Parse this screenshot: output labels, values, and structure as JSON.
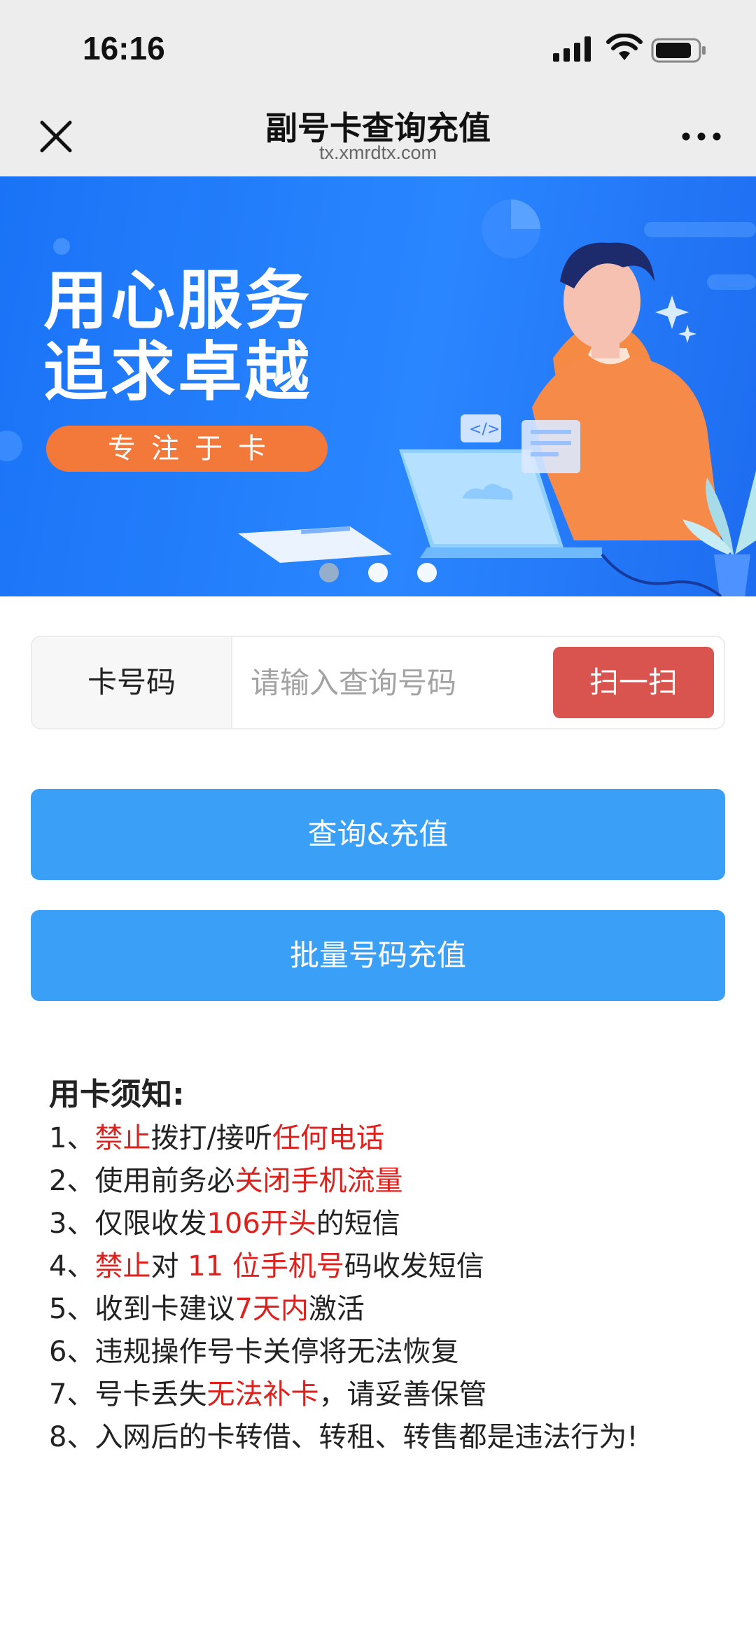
{
  "status_bar": {
    "time": "16:16"
  },
  "nav": {
    "title": "副号卡查询充值",
    "url": "tx.xmrdtx.com"
  },
  "banner": {
    "line1": "用心服务",
    "line2": "追求卓越",
    "tag": "专注于卡",
    "slides": 3,
    "active_slide": 1
  },
  "query": {
    "label": "卡号码",
    "placeholder": "请输入查询号码",
    "scan_label": "扫一扫"
  },
  "buttons": {
    "query_recharge": "查询&充值",
    "batch_recharge": "批量号码充值"
  },
  "notice": {
    "title": "用卡须知:",
    "items": [
      [
        {
          "t": "1、"
        },
        {
          "t": "禁止",
          "red": true
        },
        {
          "t": "拨打/接听"
        },
        {
          "t": "任何电话",
          "red": true
        }
      ],
      [
        {
          "t": "2、使用前务必"
        },
        {
          "t": "关闭手机流量",
          "red": true
        }
      ],
      [
        {
          "t": "3、仅限收发"
        },
        {
          "t": "106开头",
          "red": true
        },
        {
          "t": "的短信"
        }
      ],
      [
        {
          "t": "4、"
        },
        {
          "t": "禁止",
          "red": true
        },
        {
          "t": "对 "
        },
        {
          "t": "11 位手机号",
          "red": true
        },
        {
          "t": "码收发短信"
        }
      ],
      [
        {
          "t": "5、收到卡建议"
        },
        {
          "t": "7天内",
          "red": true
        },
        {
          "t": "激活"
        }
      ],
      [
        {
          "t": "6、违规操作号卡关停将无法恢复"
        }
      ],
      [
        {
          "t": "7、号卡丢失"
        },
        {
          "t": "无法补卡",
          "red": true
        },
        {
          "t": "，请妥善保管"
        }
      ],
      [
        {
          "t": "8、入网后的卡转借、转租、转售都是违法行为!"
        }
      ]
    ]
  },
  "colors": {
    "accent_blue": "#3aa0f7",
    "scan_red": "#d9534f",
    "highlight_red": "#e0201c",
    "banner_blue": "#1a73f6",
    "tag_orange": "#f2793a"
  }
}
